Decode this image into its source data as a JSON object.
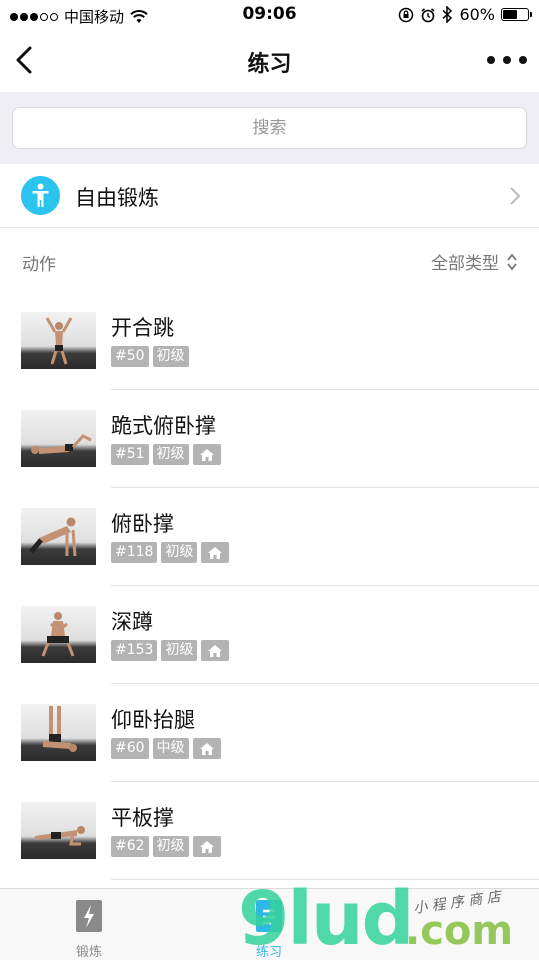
{
  "status_bar": {
    "carrier": "中国移动",
    "time": "09:06",
    "battery": "60%",
    "battery_level": 0.6,
    "icons": [
      "signal-dots",
      "wifi-icon",
      "rotation-lock-icon",
      "alarm-icon",
      "bluetooth-icon",
      "battery-icon"
    ]
  },
  "nav": {
    "title": "练习",
    "back_icon": "back-chevron-icon",
    "more_icon": "more-dots-icon"
  },
  "search": {
    "placeholder": "搜索"
  },
  "free_workout": {
    "label": "自由锻炼",
    "icon": "person-icon",
    "accent": "#2bc4ee"
  },
  "section": {
    "label": "动作",
    "filter_label": "全部类型"
  },
  "exercises": [
    {
      "name": "开合跳",
      "tags": [
        "#50",
        "初级"
      ],
      "home": false
    },
    {
      "name": "跪式俯卧撑",
      "tags": [
        "#51",
        "初级"
      ],
      "home": true
    },
    {
      "name": "俯卧撑",
      "tags": [
        "#118",
        "初级"
      ],
      "home": true
    },
    {
      "name": "深蹲",
      "tags": [
        "#153",
        "初级"
      ],
      "home": true
    },
    {
      "name": "仰卧抬腿",
      "tags": [
        "#60",
        "中级"
      ],
      "home": true
    },
    {
      "name": "平板撑",
      "tags": [
        "#62",
        "初级"
      ],
      "home": true
    }
  ],
  "tabbar": {
    "tabs": [
      {
        "label": "锻炼",
        "icon": "lightning-notebook-icon",
        "active": false
      },
      {
        "label": "练习",
        "icon": "practice-icon",
        "active": true
      }
    ],
    "active_color": "#2fb7e8"
  },
  "watermark": {
    "main": "9lud",
    "suffix": ".com",
    "sub": "小 程 序 商 店"
  }
}
